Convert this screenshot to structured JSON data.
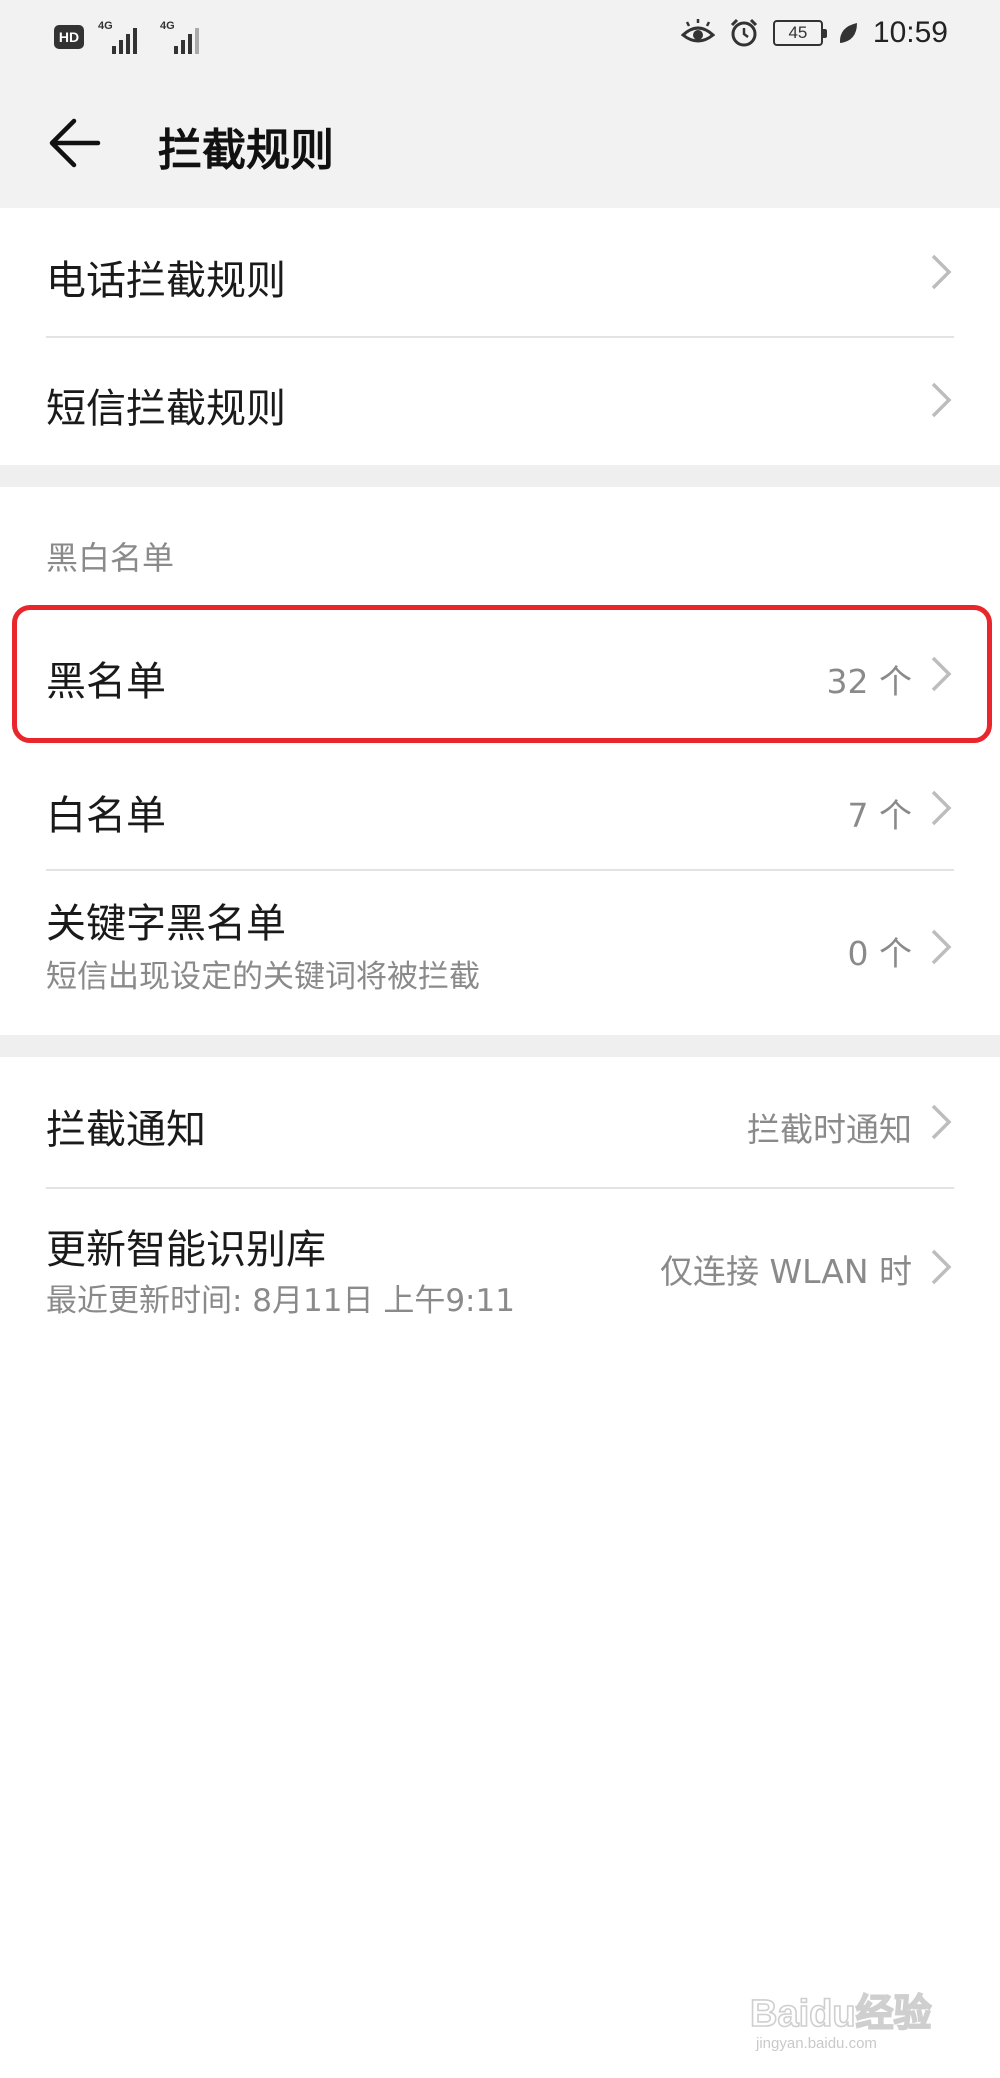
{
  "status_bar": {
    "hd_badge": "HD",
    "sim1_label": "4G",
    "sim2_label": "4G",
    "battery_level": "45",
    "time": "10:59"
  },
  "app_bar": {
    "title": "拦截规则"
  },
  "rules": [
    {
      "label": "电话拦截规则"
    },
    {
      "label": "短信拦截规则"
    }
  ],
  "lists_section": {
    "header": "黑白名单",
    "items": [
      {
        "label": "黑名单",
        "value": "32 个",
        "highlighted": true
      },
      {
        "label": "白名单",
        "value": "7 个"
      },
      {
        "label": "关键字黑名单",
        "sub": "短信出现设定的关键词将被拦截",
        "value": "0 个"
      }
    ]
  },
  "settings": [
    {
      "label": "拦截通知",
      "value": "拦截时通知"
    },
    {
      "label": "更新智能识别库",
      "sub": "最近更新时间: 8月11日 上午9:11",
      "value": "仅连接 WLAN 时"
    }
  ],
  "watermark": {
    "text": "Baidu经验",
    "url": "jingyan.baidu.com"
  },
  "colors": {
    "highlight": "#e8262b",
    "background": "#ffffff",
    "header_bg": "#f2f2f2"
  }
}
